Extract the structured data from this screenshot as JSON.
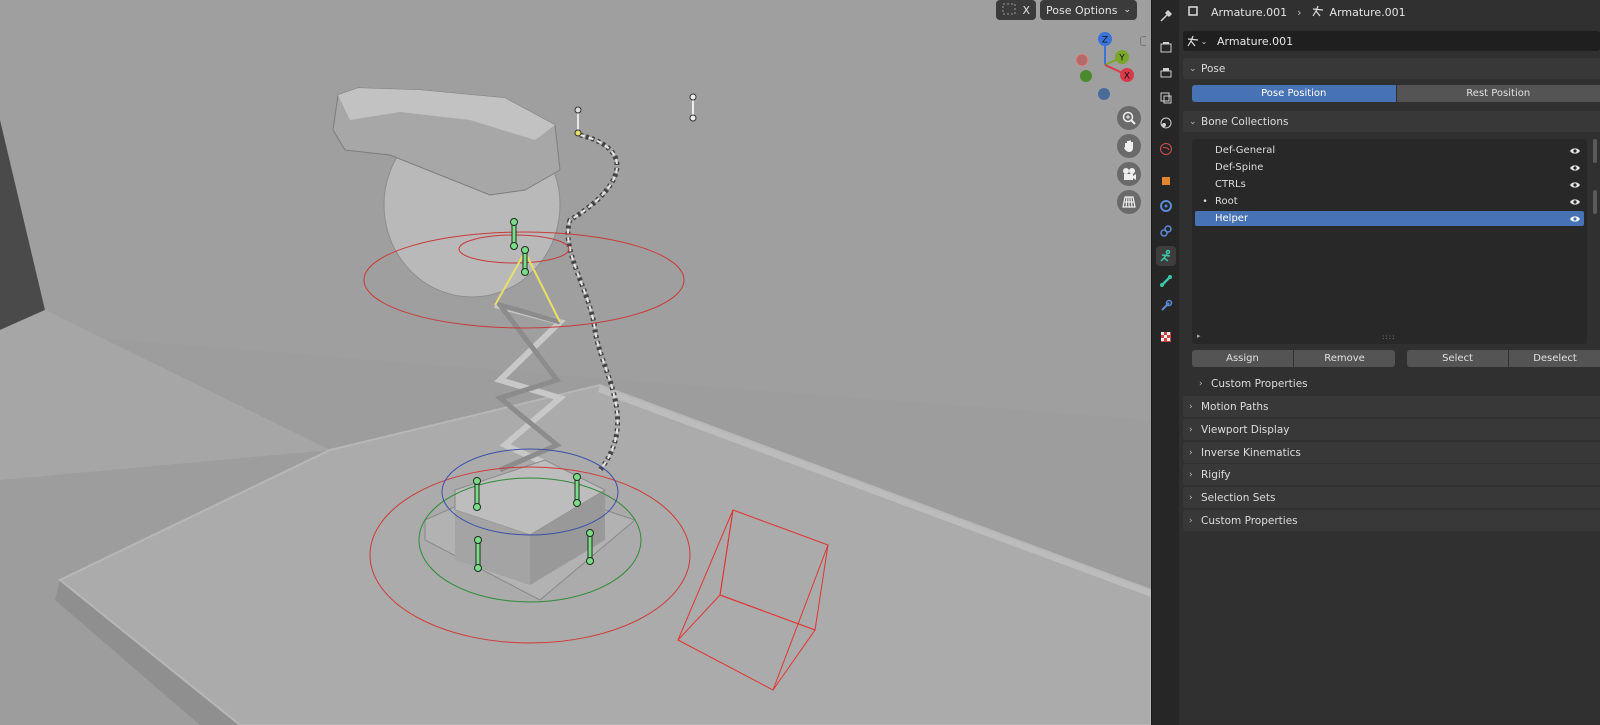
{
  "viewport": {
    "xray_label": "X",
    "pose_options_label": "Pose Options",
    "gizmo": {
      "z": "Z",
      "y": "Y",
      "x": "X"
    }
  },
  "header": {
    "object_name": "Armature.001",
    "data_name": "Armature.001"
  },
  "datablock": {
    "name": "Armature.001"
  },
  "pose_panel": {
    "title": "Pose",
    "pose_position_label": "Pose Position",
    "rest_position_label": "Rest Position"
  },
  "bone_collections": {
    "title": "Bone Collections",
    "items": [
      {
        "label": "Def-General",
        "active": false
      },
      {
        "label": "Def-Spine",
        "active": false
      },
      {
        "label": "CTRLs",
        "active": false
      },
      {
        "label": "Root",
        "active": false,
        "bullet": "•"
      },
      {
        "label": "Helper",
        "active": true
      }
    ],
    "assign_label": "Assign",
    "remove_label": "Remove",
    "select_label": "Select",
    "deselect_label": "Deselect",
    "custom_properties_label": "Custom Properties"
  },
  "panels": [
    {
      "label": "Motion Paths"
    },
    {
      "label": "Viewport Display"
    },
    {
      "label": "Inverse Kinematics"
    },
    {
      "label": "Rigify"
    },
    {
      "label": "Selection Sets"
    },
    {
      "label": "Custom Properties"
    }
  ],
  "colors": {
    "accent": "#4772b3",
    "viewport_bg": "#9c9c9c",
    "bone_green": "#7ddc8a",
    "circle_red": "#c83a3a"
  }
}
